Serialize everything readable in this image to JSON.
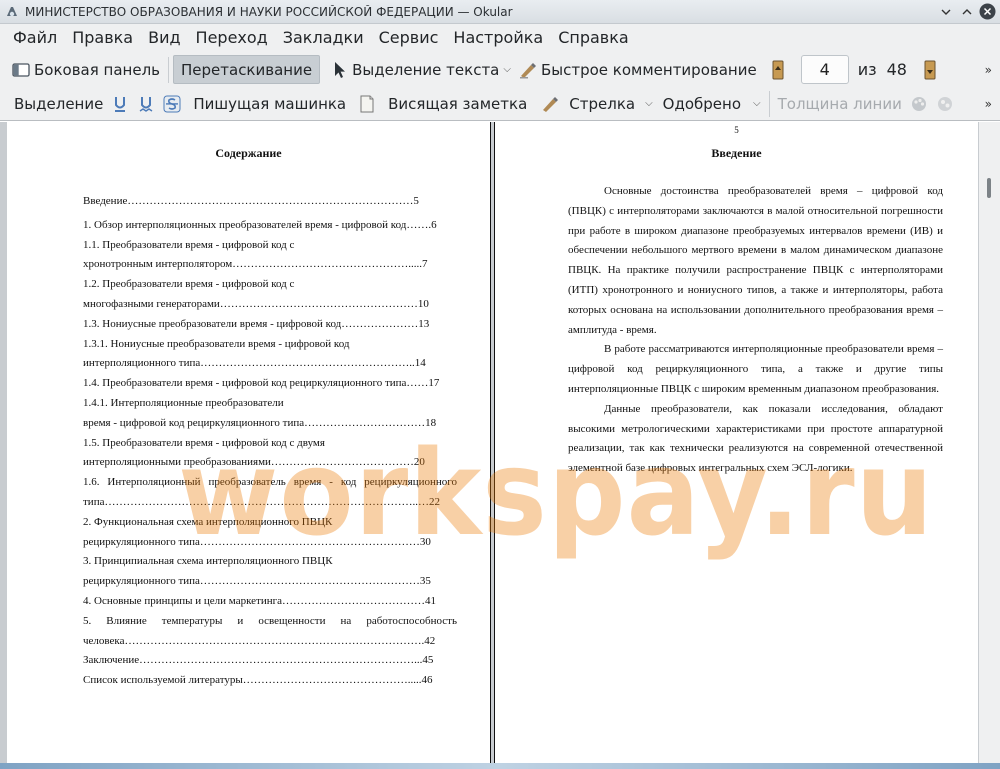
{
  "window": {
    "title": "МИНИСТЕРСТВО ОБРАЗОВАНИЯ И НАУКИ РОССИЙСКОЙ ФЕДЕРАЦИИ  — Okular"
  },
  "menu": [
    "Файл",
    "Правка",
    "Вид",
    "Переход",
    "Закладки",
    "Сервис",
    "Настройка",
    "Справка"
  ],
  "toolbar1": {
    "sidebar": "Боковая панель",
    "drag": "Перетаскивание",
    "text_select": "Выделение текста",
    "quick_comment": "Быстрое комментирование",
    "page_current": "4",
    "page_of": "из",
    "page_total": "48"
  },
  "toolbar2": {
    "highlight": "Выделение",
    "typewriter": "Пишущая машинка",
    "sticky_note": "Висящая заметка",
    "arrow": "Стрелка",
    "stamp": "Одобрено",
    "line_width": "Толщина линии"
  },
  "left_page": {
    "heading": "Содержание",
    "toc": [
      "Введение……………………………………………………………………5",
      "1. Обзор интерполяционных преобразователей время - цифровой код…….6",
      "1.1. Преобразователи время - цифровой код с",
      "хронотронным интерполятором………………………………………….....7",
      "1.2. Преобразователи время - цифровой код с",
      "многофазными генераторами………………………………………………10",
      "1.3. Нониусные преобразователи время - цифровой код…………………13",
      "1.3.1. Нониусные преобразователи время - цифровой код",
      "интерполяционного типа…………………………………………………..14",
      "1.4. Преобразователи время - цифровой код рециркуляционного типа……17",
      "1.4.1. Интерполяционные преобразователи",
      "время - цифровой код рециркуляционного типа……………………………18",
      "1.5. Преобразователи время - цифровой код с двумя",
      "интерполяционными преобразованиями…………………………………20",
      "1.6. Интерполяционный преобразователь время - код рециркуляционного",
      "типа…………………………………………………………………………..…22",
      "2. Функциональная схема интерполяционного ПВЦК",
      "рециркуляционного типа……………………………………………………30",
      "3. Принципиальная схема интерполяционного ПВЦК",
      "рециркуляционного типа……………………………………………………35",
      "4. Основные принципы и цели маркетинга…………………………………41",
      "5. Влияние температуры и освещенности на работоспособность",
      "человека……………………………………………………………………….42",
      "Заключение…………………………………………………………………...45",
      "Список используемой литературы……………………………………….....46"
    ]
  },
  "right_page": {
    "page_number": "5",
    "heading": "Введение",
    "paragraphs": [
      "Основные достоинства преобразователей время – цифровой код (ПВЦК) с интерполяторами заключаются в малой относительной погрешности при работе в широком диапазоне преобразуемых интервалов времени (ИВ) и обеспечении небольшого мертвого времени в малом динамическом  диапазоне ПВЦК. На практике получили распространение ПВЦК с интерполяторами (ИТП) хронотронного и нониусного типов, а также и  интерполяторы, работа которых основана на использовании дополнительного преобразования время – амплитуда - время.",
      "В работе рассматриваются интерполяционные преобразователи время – цифровой код рециркуляционного типа, а также и другие типы интерполяционные ПВЦК с широким временным диапазоном преобразования.",
      "Данные преобразователи, как показали исследования, обладают высокими метрологическими характеристиками при простоте аппаратурной реализации, так как технически реализуются на современной отечественной элементной базе цифровых интегральных схем ЭСЛ-логики."
    ]
  },
  "watermark": "workspay.ru"
}
